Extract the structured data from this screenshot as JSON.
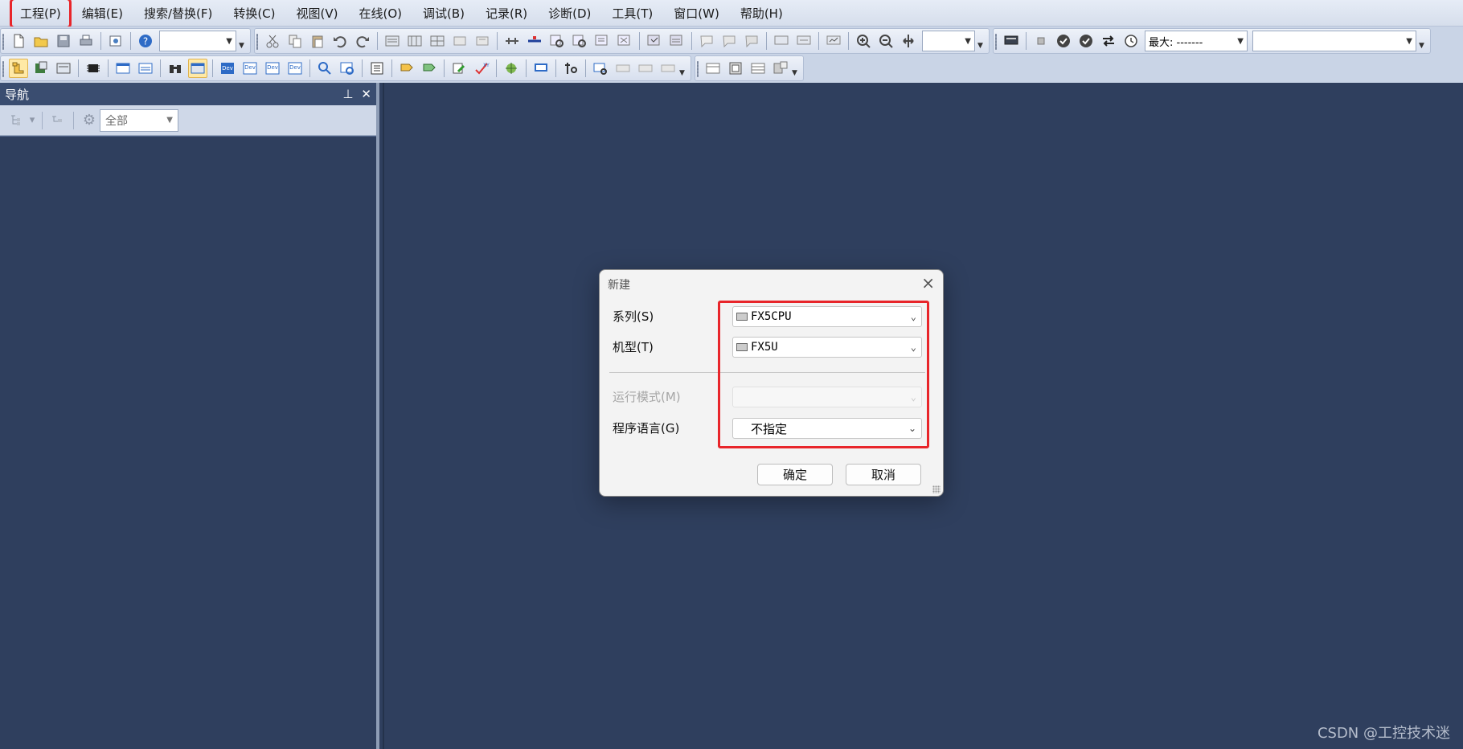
{
  "menu": [
    "工程(P)",
    "编辑(E)",
    "搜索/替换(F)",
    "转换(C)",
    "视图(V)",
    "在线(O)",
    "调试(B)",
    "记录(R)",
    "诊断(D)",
    "工具(T)",
    "窗口(W)",
    "帮助(H)"
  ],
  "toolbar": {
    "zoom_value": "",
    "max_label": "最大: -------"
  },
  "navigation": {
    "title": "导航",
    "filter_value": "全部"
  },
  "dialog": {
    "title": "新建",
    "series_label": "系列(S)",
    "series_value": "FX5CPU",
    "model_label": "机型(T)",
    "model_value": "FX5U",
    "run_mode_label": "运行模式(M)",
    "run_mode_value": "",
    "language_label": "程序语言(G)",
    "language_value": "不指定",
    "ok_label": "确定",
    "cancel_label": "取消"
  },
  "watermark": "CSDN @工控技术迷",
  "colors": {
    "highlight_red": "#e8252a",
    "workspace_bg": "#2f3f5e"
  }
}
